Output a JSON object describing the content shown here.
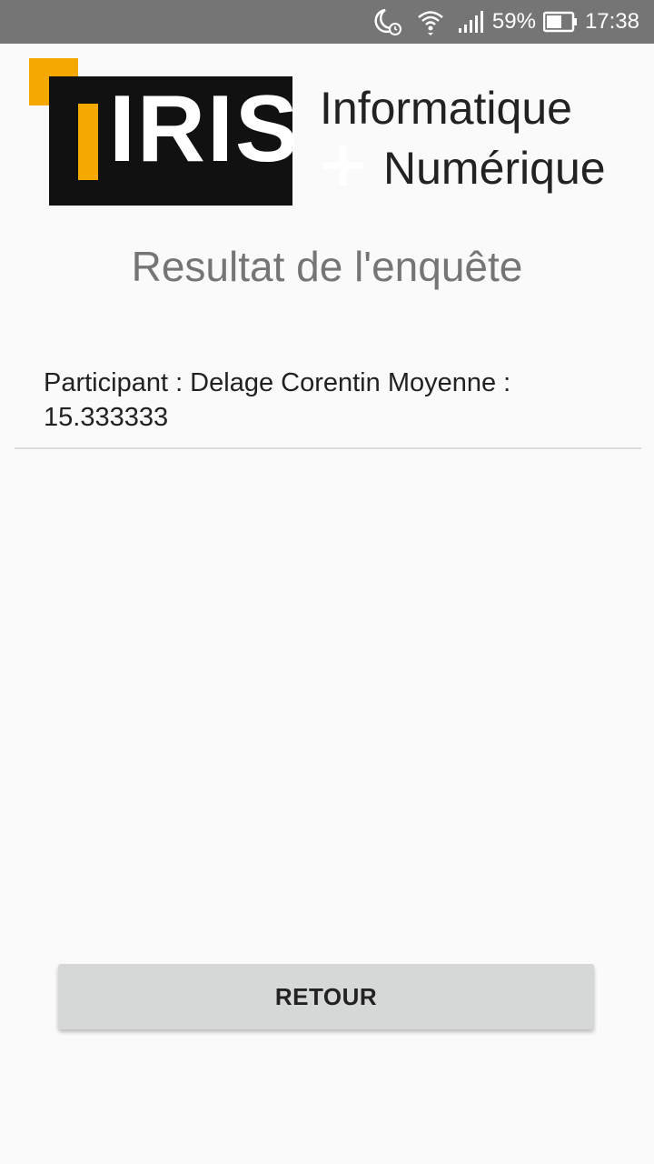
{
  "status_bar": {
    "battery_percent": "59%",
    "time": "17:38",
    "icons": [
      "moon-alarm-icon",
      "wifi-icon",
      "signal-icon",
      "battery-icon"
    ]
  },
  "logo": {
    "brand": "IRIS",
    "line1": "Informatique",
    "line2": "Numérique",
    "colors": {
      "accent": "#f5a800",
      "box": "#111111"
    }
  },
  "page": {
    "title": "Resultat de l'enquête"
  },
  "results": [
    {
      "text": "Participant : Delage Corentin Moyenne : 15.333333"
    }
  ],
  "actions": {
    "back_label": "RETOUR"
  }
}
